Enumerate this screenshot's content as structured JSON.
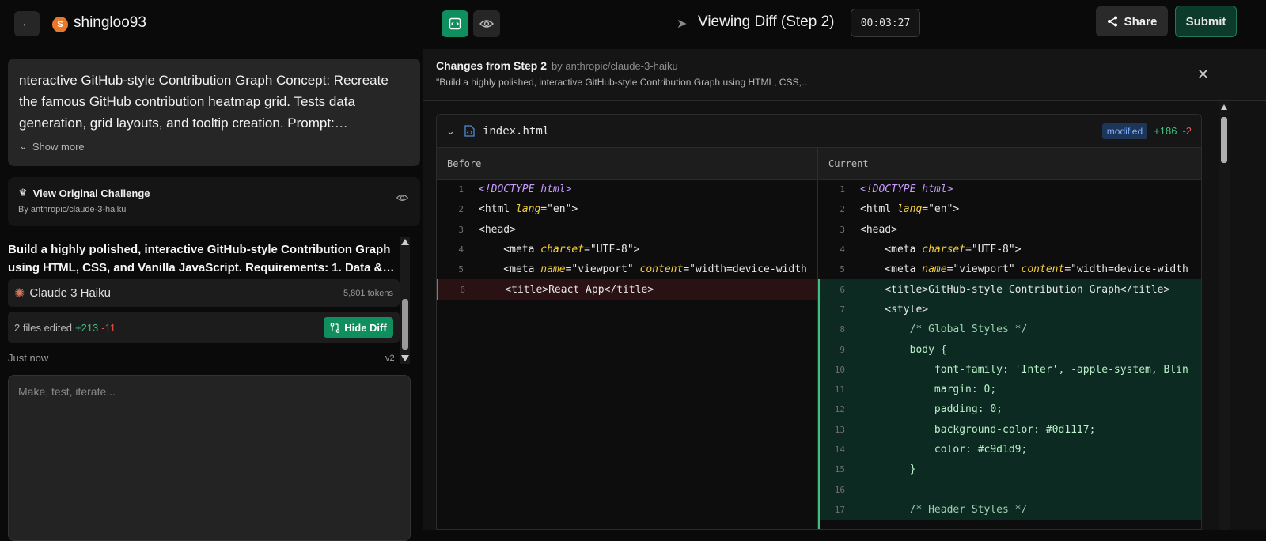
{
  "topbar": {
    "username": "shingloo93",
    "avatar_letter": "S",
    "view_title": "Viewing Diff (Step 2)",
    "timer": "00:03:27",
    "share_label": "Share",
    "submit_label": "Submit"
  },
  "left": {
    "prompt_text": "nteractive GitHub-style Contribution Graph Concept: Recreate the famous GitHub contribution heatmap grid. Tests data generation, grid layouts, and tooltip creation. Prompt:…",
    "show_more": "Show more",
    "orig_title": "View Original Challenge",
    "orig_by": "By anthropic/claude-3-haiku",
    "step_title": "Build a highly polished, interactive GitHub-style Contribution Graph using HTML, CSS, and Vanilla JavaScript. Requirements: 1. Data &…",
    "model_name": "Claude 3 Haiku",
    "tokens": "5,801 tokens",
    "files_edited": "2 files edited",
    "files_add": "+213",
    "files_del": "-11",
    "hide_diff": "Hide Diff",
    "just_now": "Just now",
    "version": "v2",
    "composer_placeholder": "Make, test, iterate..."
  },
  "diff": {
    "title": "Changes from Step 2",
    "by": "by anthropic/claude-3-haiku",
    "subtitle": "\"Build a highly polished, interactive GitHub-style Contribution Graph using HTML, CSS,…",
    "file_name": "index.html",
    "badge": "modified",
    "add": "+186",
    "del": "-2",
    "before_label": "Before",
    "current_label": "Current",
    "before_lines": [
      "1",
      "2",
      "3",
      "4",
      "5",
      "6"
    ],
    "current_lines": [
      "1",
      "2",
      "3",
      "4",
      "5",
      "6",
      "7",
      "8",
      "9",
      "10",
      "11",
      "12",
      "13",
      "14",
      "15",
      "16",
      "17"
    ]
  },
  "colors": {
    "accent": "#0f8f5e",
    "added": "#3fbf7f",
    "removed": "#e5534b"
  }
}
